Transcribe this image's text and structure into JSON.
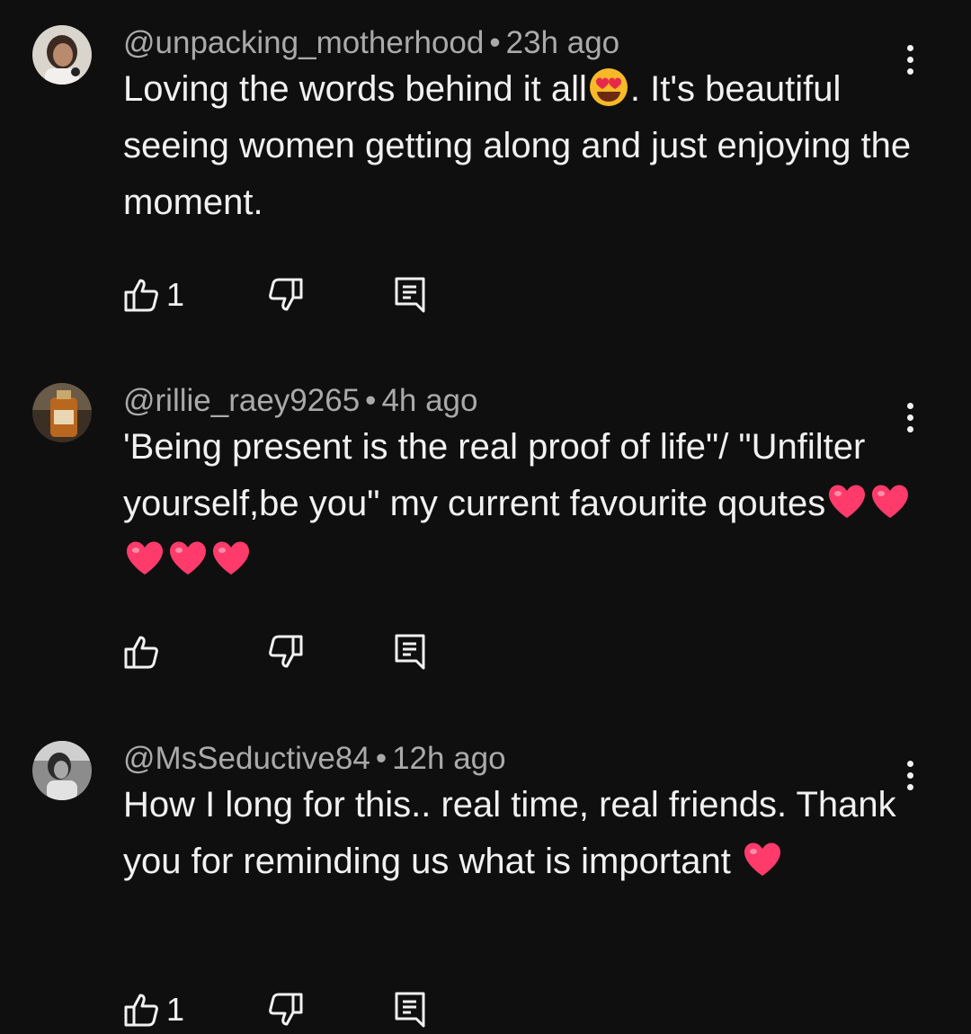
{
  "comments": [
    {
      "handle": "@unpacking_motherhood",
      "separator": "•",
      "time": "23h ago",
      "text_parts": [
        "Loving the words behind it all",
        ". It's beautiful seeing women getting along and just enjoying the moment."
      ],
      "emojis": [
        "heart-eyes-emoji"
      ],
      "likes": "1",
      "avatar": "avatar-woman-light"
    },
    {
      "handle": "@rillie_raey9265",
      "separator": "•",
      "time": "4h ago",
      "text_parts": [
        "'Being present is the real proof of life\"/ \"Unfilter yourself,be you\" my current favourite qoutes"
      ],
      "emojis": [
        "pink-heart-emoji",
        "pink-heart-emoji",
        "pink-heart-emoji",
        "pink-heart-emoji",
        "pink-heart-emoji"
      ],
      "likes": "",
      "avatar": "avatar-bottle-brown"
    },
    {
      "handle": "@MsSeductive84",
      "separator": "•",
      "time": "12h ago",
      "text_parts": [
        "How I long for this.. real time, real friends. Thank you for reminding us what is important "
      ],
      "emojis": [
        "pink-heart-emoji"
      ],
      "likes": "1",
      "avatar": "avatar-woman-gray"
    }
  ],
  "colors": {
    "background": "#0f0f0f",
    "text": "#f1f1f1",
    "meta": "#aaaaaa",
    "heart": "#ff3b6b"
  }
}
